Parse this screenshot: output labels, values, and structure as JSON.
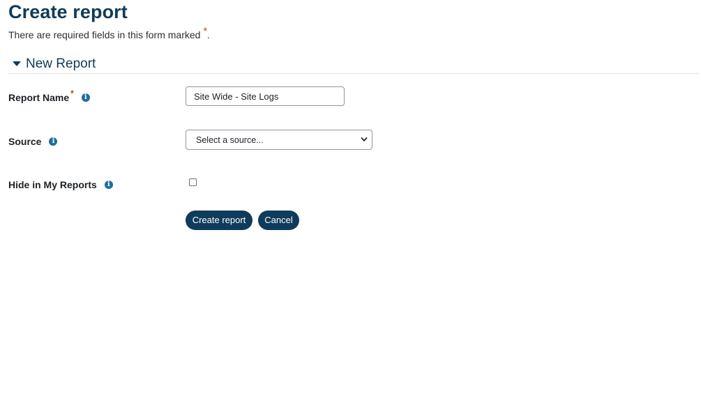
{
  "page": {
    "title": "Create report",
    "required_note": "There are required fields in this form marked",
    "required_marker": "*",
    "required_suffix": "."
  },
  "section": {
    "title": "New Report",
    "toggle_icon": "caret-down-icon"
  },
  "fields": {
    "report_name": {
      "label": "Report Name",
      "required_marker": "*",
      "value": "Site Wide - Site Logs",
      "help_icon": "info-icon"
    },
    "source": {
      "label": "Source",
      "selected": "Select a source...",
      "help_icon": "info-icon"
    },
    "hide_in_my_reports": {
      "label": "Hide in My Reports",
      "checked": false,
      "help_icon": "info-icon"
    }
  },
  "buttons": {
    "create": "Create report",
    "cancel": "Cancel"
  },
  "colors": {
    "primary": "#0f3c5a",
    "info_icon": "#1f6e9c",
    "required": "#c0392b"
  }
}
